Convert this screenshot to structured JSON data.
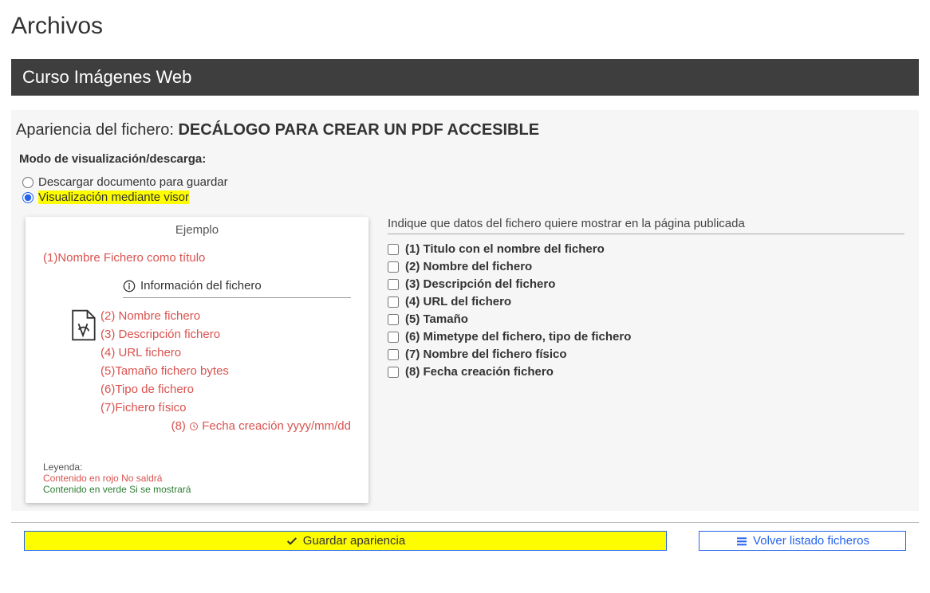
{
  "page_title": "Archivos",
  "course_bar": "Curso Imágenes Web",
  "section": {
    "prefix": "Apariencia del fichero: ",
    "name": "DECÁLOGO PARA CREAR UN PDF ACCESIBLE"
  },
  "mode_label": "Modo de visualización/descarga:",
  "radios": {
    "download": "Descargar documento para guardar",
    "viewer": "Visualización mediante visor"
  },
  "example": {
    "title": "Ejemplo",
    "row1": "(1)Nombre Fichero como título",
    "info_head": "Información del fichero",
    "row2": "(2) Nombre fichero",
    "row3": "(3) Descripción fichero",
    "row4": "(4) URL fichero",
    "row5": "(5)Tamaño fichero bytes",
    "row6": "(6)Tipo de fichero",
    "row7": "(7)Fichero físico",
    "row8_prefix": "(8) ",
    "row8_text": " Fecha creación yyyy/mm/dd",
    "legend_label": "Leyenda:",
    "legend_red": "Contenido en rojo No saldrá",
    "legend_green": "Contenido en verde Si se mostrará"
  },
  "right": {
    "head": "Indique que datos del fichero quiere mostrar en la página publicada",
    "items": [
      "(1) Titulo con el nombre del fichero",
      "(2) Nombre del fichero",
      "(3) Descripción del fichero",
      "(4) URL del fichero",
      "(5) Tamaño",
      "(6) Mimetype del fichero, tipo de fichero",
      "(7) Nombre del fichero físico",
      "(8) Fecha creación fichero"
    ]
  },
  "buttons": {
    "save": "Guardar apariencia",
    "back": "Volver listado ficheros"
  }
}
